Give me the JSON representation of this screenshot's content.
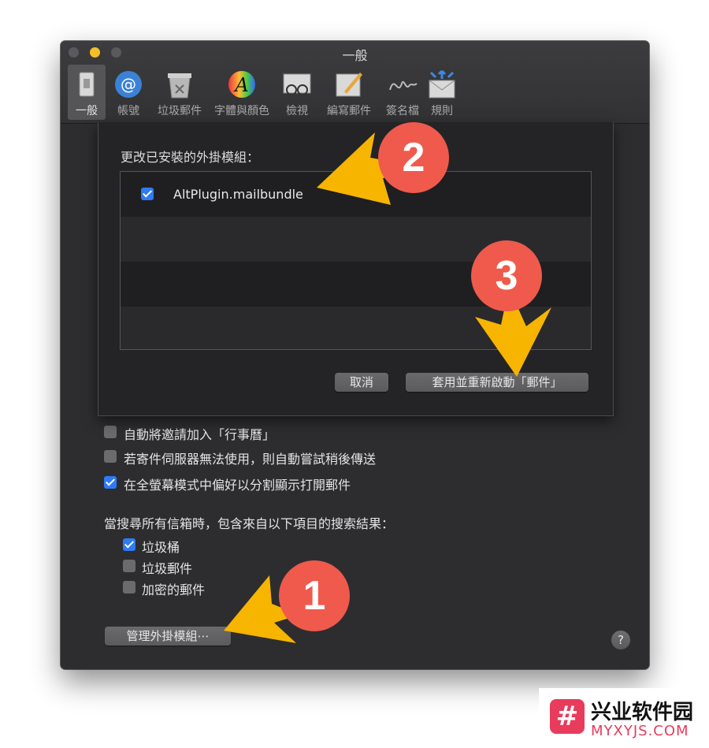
{
  "window": {
    "title": "一般",
    "toolbar": [
      {
        "label": "一般",
        "icon": "general-icon",
        "active": true
      },
      {
        "label": "帳號",
        "icon": "accounts-icon"
      },
      {
        "label": "垃圾郵件",
        "icon": "junk-mail-icon"
      },
      {
        "label": "字體與顏色",
        "icon": "fonts-colors-icon"
      },
      {
        "label": "檢視",
        "icon": "viewing-icon"
      },
      {
        "label": "編寫郵件",
        "icon": "composing-icon"
      },
      {
        "label": "簽名檔",
        "icon": "signatures-icon"
      },
      {
        "label": "規則",
        "icon": "rules-icon"
      }
    ]
  },
  "sheet": {
    "title": "更改已安裝的外掛模組：",
    "plugins": [
      {
        "name": "AltPlugin.mailbundle",
        "checked": true
      }
    ],
    "cancel_label": "取消",
    "apply_label": "套用並重新啟動「郵件」"
  },
  "options": [
    {
      "label": "自動將邀請加入「行事曆」",
      "checked": false
    },
    {
      "label": "若寄件伺服器無法使用，則自動嘗試稍後傳送",
      "checked": false
    },
    {
      "label": "在全螢幕模式中偏好以分割顯示打開郵件",
      "checked": true
    }
  ],
  "search": {
    "heading": "當搜尋所有信箱時，包含來自以下項目的搜索結果：",
    "items": [
      {
        "label": "垃圾桶",
        "checked": true
      },
      {
        "label": "垃圾郵件",
        "checked": false
      },
      {
        "label": "加密的郵件",
        "checked": false
      }
    ]
  },
  "manage_plugins_label": "管理外掛模組⋯",
  "help_label": "?",
  "annotations": {
    "marker_1": "1",
    "marker_2": "2",
    "marker_3": "3",
    "marker_color": "#ef5a4c",
    "arrow_color": "#f7b500"
  },
  "watermark": {
    "logo": "#",
    "name": "兴业软件园",
    "domain": "MYXYJS.COM"
  }
}
